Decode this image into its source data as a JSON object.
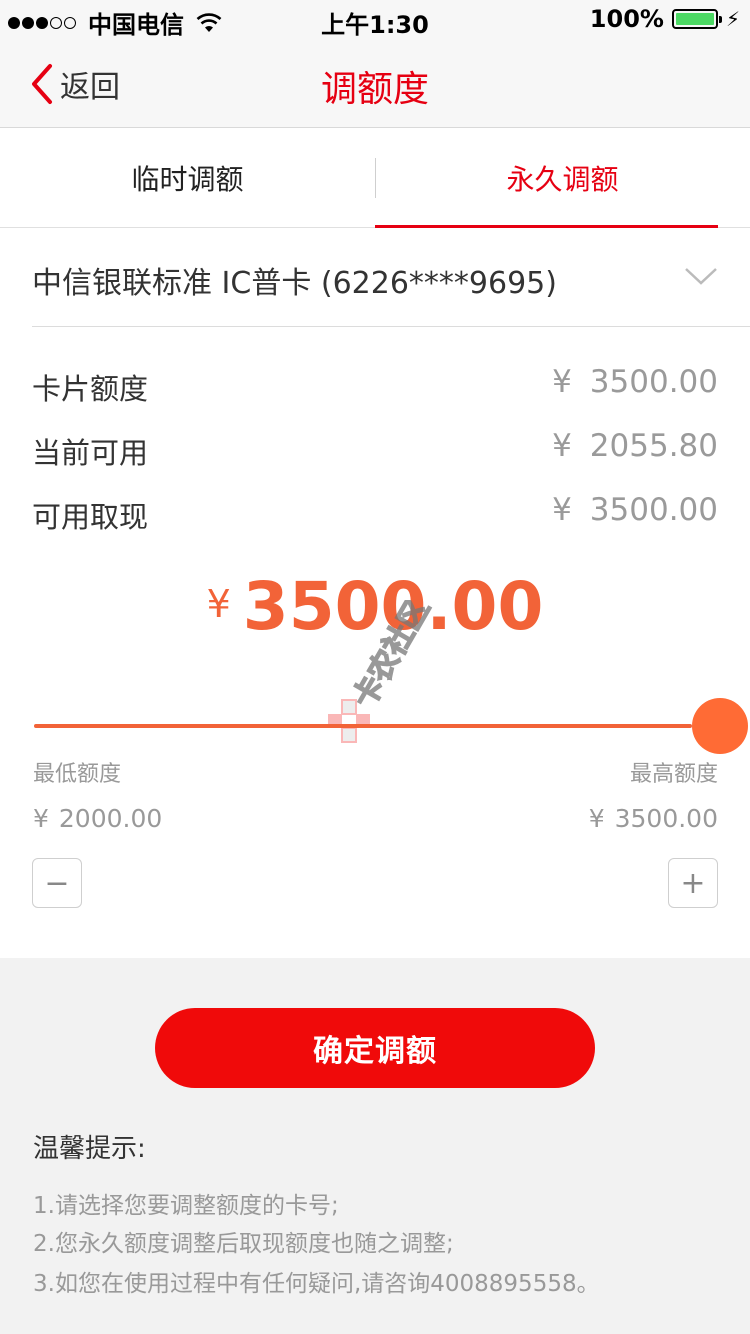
{
  "status_bar": {
    "carrier": "中国电信",
    "time": "上午1:30",
    "battery": "100%"
  },
  "nav": {
    "back_label": "返回",
    "title": "调额度"
  },
  "tabs": [
    {
      "label": "临时调额",
      "active": false
    },
    {
      "label": "永久调额",
      "active": true
    }
  ],
  "card": {
    "label": "中信银联标准  IC普卡 (6226****9695)"
  },
  "info": {
    "currency": "¥",
    "rows": [
      {
        "label": "卡片额度",
        "value": "3500.00"
      },
      {
        "label": "当前可用",
        "value": "2055.80"
      },
      {
        "label": "可用取现",
        "value": "3500.00"
      }
    ]
  },
  "amount": {
    "currency": "¥",
    "value": "3500.00"
  },
  "slider": {
    "min_label": "最低额度",
    "max_label": "最高额度",
    "min_value": "2000.00",
    "max_value": "3500.00",
    "current_fraction": 1.0
  },
  "stepper": {
    "minus": "−",
    "plus": "+"
  },
  "confirm_label": "确定调额",
  "tips": {
    "title": "温馨提示:",
    "lines": [
      "1.请选择您要调整额度的卡号;",
      "2.您永久额度调整后取现额度也随之调整;",
      "3.如您在使用过程中有任何疑问,请咨询4008895558。"
    ]
  },
  "watermark_text": "卡农社区",
  "colors": {
    "brand_red": "#e60012",
    "amount_orange": "#f26338",
    "button_red": "#f00a0a"
  }
}
